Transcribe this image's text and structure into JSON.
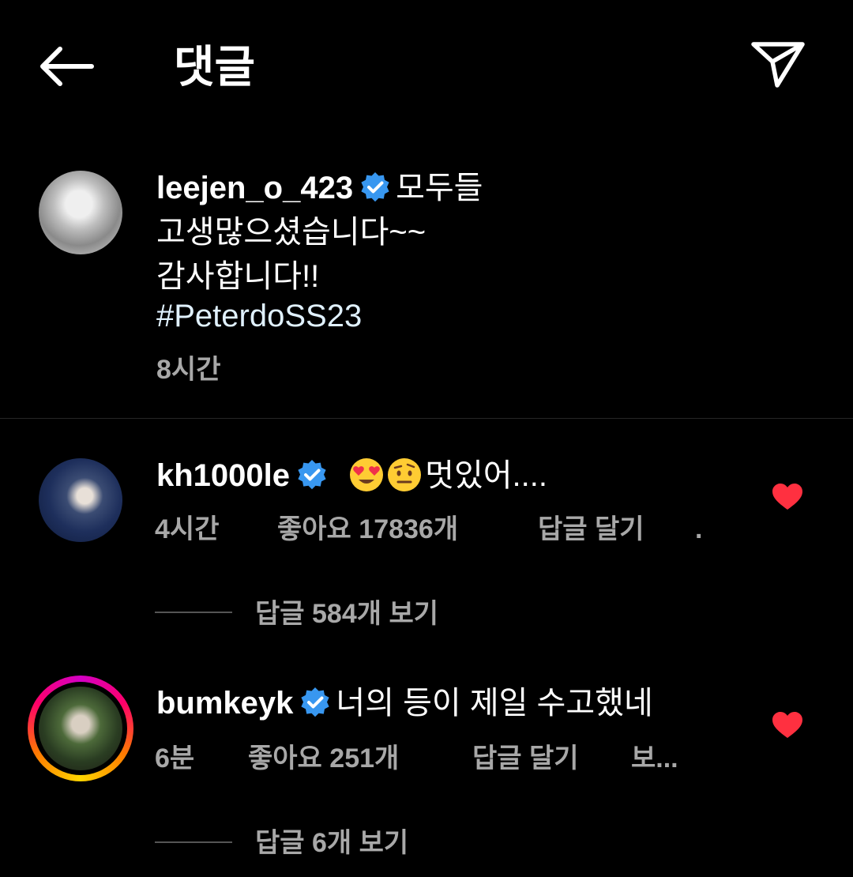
{
  "header": {
    "title": "댓글",
    "back_icon": "arrow-left-icon",
    "share_icon": "paper-plane-icon"
  },
  "caption": {
    "username": "leejen_o_423",
    "line1": "모두들",
    "line2": "고생많으셨습니다~~",
    "line3": "감사합니다!!",
    "hashtag": "#PeterdoSS23",
    "time": "8시간"
  },
  "comments": [
    {
      "username": "kh1000le",
      "emojis": [
        "heart-eyes-emoji",
        "raised-eyebrow-emoji"
      ],
      "text": "멋있어....",
      "time": "4시간",
      "likes": "좋아요 17836개",
      "reply_label": "답글 달기",
      "extra": ".",
      "view_replies": "답글 584개 보기",
      "liked": true
    },
    {
      "username": "bumkeyk",
      "text": "너의 등이 제일 수고했네",
      "time": "6분",
      "likes": "좋아요 251개",
      "reply_label": "답글 달기",
      "extra": "보...",
      "view_replies": "답글 6개 보기",
      "liked": true
    }
  ],
  "colors": {
    "background": "#000000",
    "verified": "#3897f0",
    "heart": "#ff3040",
    "meta": "#a8a8a8"
  }
}
